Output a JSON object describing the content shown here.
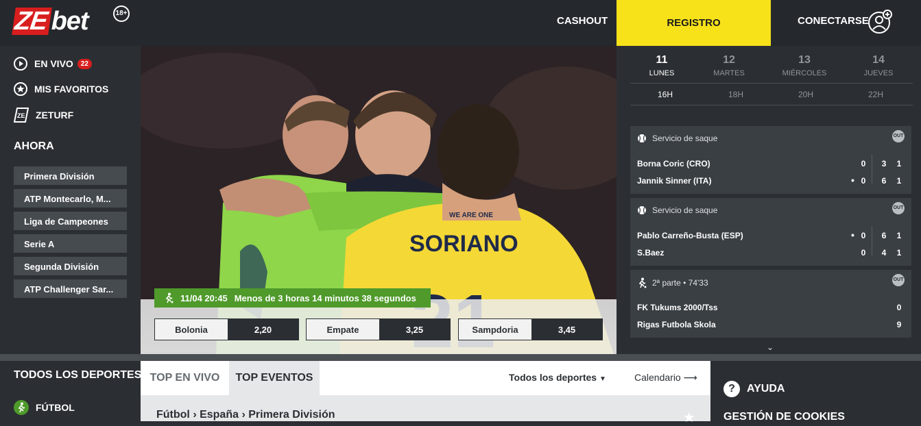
{
  "header": {
    "logo_ze": "ZE",
    "logo_bet": "bet",
    "age": "18+",
    "cashout": "CASHOUT",
    "registro": "REGISTRO",
    "conectarse": "CONECTARSE"
  },
  "sidebar": {
    "en_vivo": "EN VIVO",
    "en_vivo_count": "22",
    "favoritos": "MIS FAVORITOS",
    "zeturf": "ZETURF",
    "ahora": "AHORA",
    "leagues": [
      "Primera División",
      "ATP Montecarlo, M...",
      "Liga de Campeones",
      "Serie A",
      "Segunda División",
      "ATP Challenger Sar..."
    ]
  },
  "hero": {
    "datetime": "11/04 20:45",
    "countdown": "Menos de 3 horas 14 minutos 38 segundos",
    "jersey_name": "SORIANO",
    "jersey_number": "21",
    "jersey_tag": "WE ARE ONE",
    "odds": [
      {
        "name": "Bolonia",
        "value": "2,20"
      },
      {
        "name": "Empate",
        "value": "3,25"
      },
      {
        "name": "Sampdoria",
        "value": "3,45"
      }
    ]
  },
  "schedule": {
    "days": [
      {
        "num": "11",
        "label": "LUNES"
      },
      {
        "num": "12",
        "label": "MARTES"
      },
      {
        "num": "13",
        "label": "MIÉRCOLES"
      },
      {
        "num": "14",
        "label": "JUEVES"
      }
    ],
    "hours": [
      "16H",
      "18H",
      "20H",
      "22H"
    ]
  },
  "live": [
    {
      "status": "Servicio de saque",
      "badge": "OUT",
      "p1": "Borna Coric (CRO)",
      "p1_scores": [
        "0",
        "3",
        "1"
      ],
      "p2": "Jannik Sinner (ITA)",
      "p2_scores": [
        "0",
        "6",
        "1"
      ]
    },
    {
      "status": "Servicio de saque",
      "badge": "OUT",
      "p1": "Pablo Carreño-Busta (ESP)",
      "p1_scores": [
        "0",
        "6",
        "1"
      ],
      "p2": "S.Baez",
      "p2_scores": [
        "0",
        "4",
        "1"
      ]
    },
    {
      "status": "2ª parte • 74'33",
      "badge": "OUT",
      "p1": "FK Tukums 2000/Tss",
      "p1_score": "0",
      "p2": "Rigas Futbola Skola",
      "p2_score": "9"
    }
  ],
  "bottom": {
    "todos_deportes": "TODOS LOS DEPORTES",
    "futbol": "FÚTBOL",
    "tab_top_vivo": "TOP EN VIVO",
    "tab_top_eventos": "TOP EVENTOS",
    "todos_dropdown": "Todos los deportes",
    "calendario": "Calendario",
    "breadcrumb": "Fútbol › España › Primera División",
    "ayuda": "AYUDA",
    "cookies": "GESTIÓN DE COOKIES"
  }
}
